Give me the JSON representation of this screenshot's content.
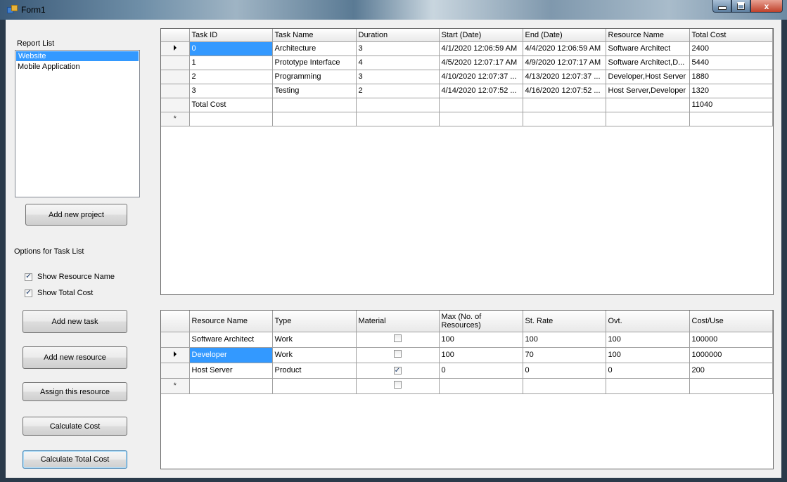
{
  "window": {
    "title": "Form1",
    "close_glyph": "x"
  },
  "left": {
    "report_list_label": "Report List",
    "report_list": [
      {
        "label": "Website",
        "selected": true
      },
      {
        "label": "Mobile Application",
        "selected": false
      }
    ],
    "add_project_label": "Add new project",
    "options_label": "Options for Task List",
    "show_resource_name": {
      "label": "Show Resource Name",
      "checked": true
    },
    "show_total_cost": {
      "label": "Show Total Cost",
      "checked": true
    },
    "buttons": {
      "add_task": "Add new task",
      "add_resource": "Add new resource",
      "assign_resource": "Assign this resource",
      "calculate_cost": "Calculate Cost",
      "calculate_total_cost": "Calculate Total Cost"
    }
  },
  "task_grid": {
    "columns": [
      "Task ID",
      "Task Name",
      "Duration",
      "Start (Date)",
      "End (Date)",
      "Resource Name",
      "Total Cost"
    ],
    "rows": [
      [
        "0",
        "Architecture",
        "3",
        "4/1/2020 12:06:59 AM",
        "4/4/2020 12:06:59 AM",
        "Software Architect",
        "2400"
      ],
      [
        "1",
        "Prototype Interface",
        "4",
        "4/5/2020 12:07:17 AM",
        "4/9/2020 12:07:17 AM",
        "Software Architect,D...",
        "5440"
      ],
      [
        "2",
        "Programming",
        "3",
        "4/10/2020 12:07:37 ...",
        "4/13/2020 12:07:37 ...",
        "Developer,Host Server",
        "1880"
      ],
      [
        "3",
        "Testing",
        "2",
        "4/14/2020 12:07:52 ...",
        "4/16/2020 12:07:52 ...",
        "Host Server,Developer",
        "1320"
      ],
      [
        "Total Cost",
        "",
        "",
        "",
        "",
        "",
        "11040"
      ]
    ],
    "new_row_marker": "*"
  },
  "resource_grid": {
    "columns": [
      "Resource Name",
      "Type",
      "Material",
      "Max (No. of Resources)",
      "St. Rate",
      "Ovt.",
      "Cost/Use"
    ],
    "rows": [
      {
        "name": "Software Architect",
        "type": "Work",
        "material": false,
        "max": "100",
        "st_rate": "100",
        "ovt": "100",
        "cost_use": "100000"
      },
      {
        "name": "Developer",
        "type": "Work",
        "material": false,
        "max": "100",
        "st_rate": "70",
        "ovt": "100",
        "cost_use": "1000000"
      },
      {
        "name": "Host Server",
        "type": "Product",
        "material": true,
        "max": "0",
        "st_rate": "0",
        "ovt": "0",
        "cost_use": "200"
      }
    ],
    "new_row_marker": "*"
  }
}
